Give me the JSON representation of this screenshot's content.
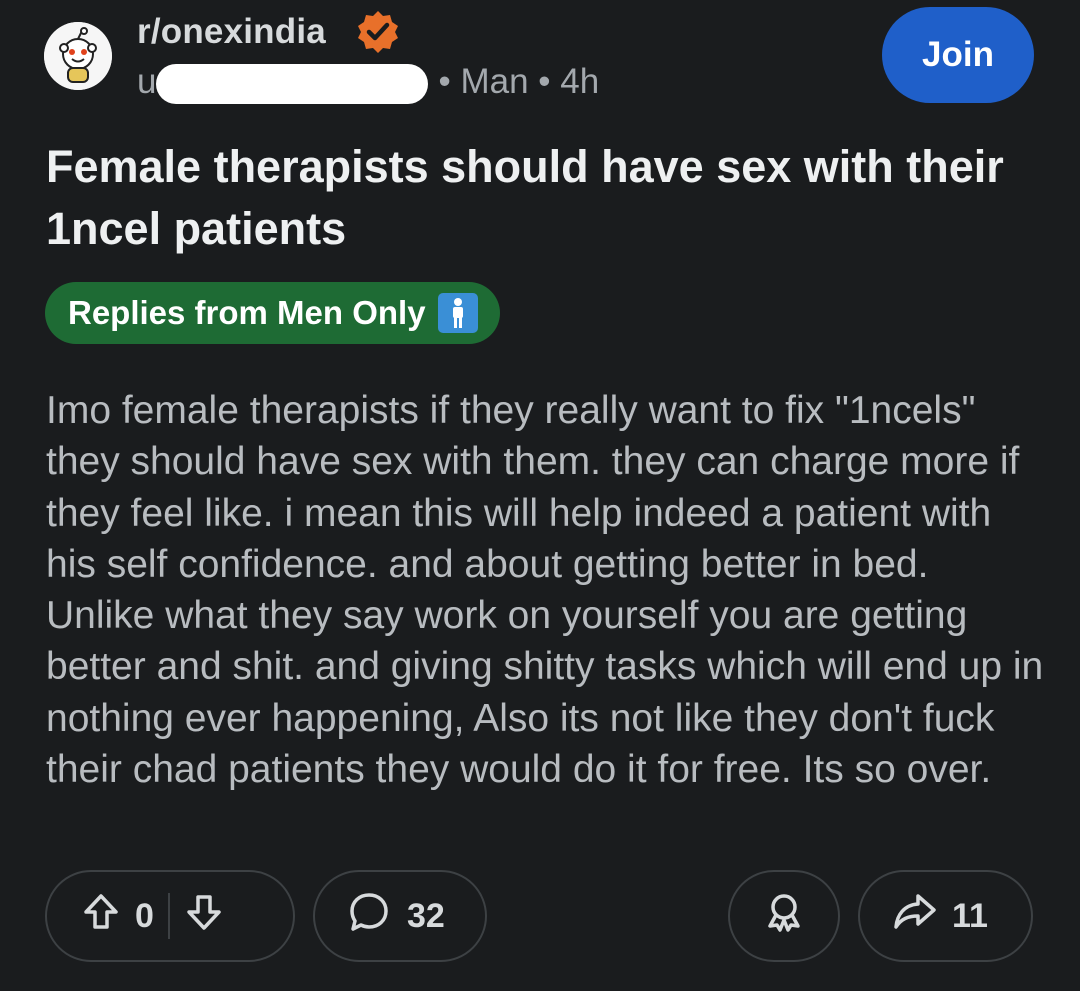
{
  "header": {
    "subreddit": "r/onexindia",
    "author_prefix": "u",
    "flair_text": "Man",
    "separator": "•",
    "time_ago": "4h",
    "join_label": "Join"
  },
  "post": {
    "title": "Female therapists should have sex with their 1ncel patients",
    "flair": "Replies from Men Only",
    "body": "Imo female therapists if they really want to fix \"1ncels\" they should have sex with them. they can charge more if they feel like. i mean this will help indeed a patient with his self confidence. and about getting better in bed. Unlike what they say work on yourself you are getting better and shit. and giving shitty tasks which will end up in nothing ever happening, Also its not like they don't fuck their chad patients they would do it for free. Its so over."
  },
  "actions": {
    "vote_count": "0",
    "comment_count": "32",
    "share_count": "11"
  },
  "colors": {
    "background": "#1a1c1e",
    "join_button": "#1f5fc9",
    "flair_bg": "#1e6b34",
    "verified_badge": "#e8702a"
  },
  "icons": {
    "avatar": "snoo-avatar-icon",
    "verified": "verified-badge-icon",
    "flair_emoji": "man-emoji-icon",
    "upvote": "upvote-arrow-icon",
    "downvote": "downvote-arrow-icon",
    "comment": "comment-bubble-icon",
    "award": "award-icon",
    "share": "share-arrow-icon"
  }
}
